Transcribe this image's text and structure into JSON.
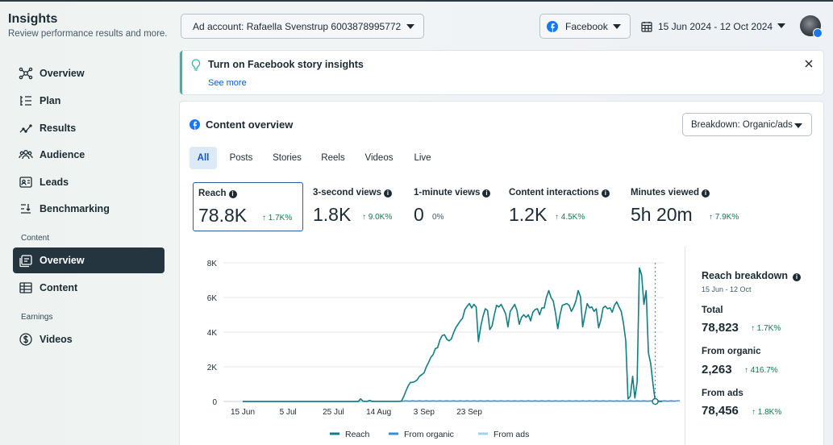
{
  "app": {
    "title": "Insights",
    "subtitle": "Review performance results and more."
  },
  "sidebar": {
    "items": [
      {
        "label": "Overview",
        "icon": "network-icon"
      },
      {
        "label": "Plan",
        "icon": "plan-list-icon"
      },
      {
        "label": "Results",
        "icon": "trend-icon"
      },
      {
        "label": "Audience",
        "icon": "people-icon"
      },
      {
        "label": "Leads",
        "icon": "id-card-icon"
      },
      {
        "label": "Benchmarking",
        "icon": "benchmark-icon"
      }
    ],
    "content_section": "Content",
    "content_items": [
      {
        "label": "Overview",
        "icon": "content-overview-icon",
        "active": true
      },
      {
        "label": "Content",
        "icon": "table-icon"
      }
    ],
    "earnings_section": "Earnings",
    "earnings_items": [
      {
        "label": "Videos",
        "icon": "dollar-icon"
      }
    ]
  },
  "topbar": {
    "ad_account": "Ad account: Rafaella Svenstrup 6003878995772",
    "platform": "Facebook",
    "date_range": "15 Jun 2024 - 12 Oct 2024"
  },
  "banner": {
    "title": "Turn on Facebook story insights",
    "link": "See more"
  },
  "content": {
    "title": "Content overview",
    "breakdown": "Breakdown: Organic/ads",
    "tabs": [
      "All",
      "Posts",
      "Stories",
      "Reels",
      "Videos",
      "Live"
    ],
    "active_tab": "All",
    "metrics": [
      {
        "label": "Reach",
        "value": "78.8K",
        "change": "↑ 1.7K%"
      },
      {
        "label": "3-second views",
        "value": "1.8K",
        "change": "↑ 9.0K%"
      },
      {
        "label": "1-minute views",
        "value": "0",
        "change": "0%"
      },
      {
        "label": "Content interactions",
        "value": "1.2K",
        "change": "↑ 4.5K%"
      },
      {
        "label": "Minutes viewed",
        "value": "5h 20m",
        "change": "↑ 7.9K%"
      }
    ]
  },
  "reach_breakdown": {
    "title": "Reach breakdown",
    "date": "15 Jun - 12 Oct",
    "rows": [
      {
        "label": "Total",
        "value": "78,823",
        "change": "↑ 1.7K%"
      },
      {
        "label": "From organic",
        "value": "2,263",
        "change": "↑ 416.7%"
      },
      {
        "label": "From ads",
        "value": "78,456",
        "change": "↑ 1.8K%"
      }
    ]
  },
  "chart_data": {
    "type": "line",
    "x_ticks": [
      "15 Jun",
      "5 Jul",
      "25 Jul",
      "14 Aug",
      "3 Sep",
      "23 Sep"
    ],
    "y_ticks": [
      "0",
      "2K",
      "4K",
      "6K",
      "8K"
    ],
    "ylim": [
      0,
      8000
    ],
    "colors": {
      "reach": "#137d84",
      "organic": "#3b8fd1",
      "ads": "#9fd2ee"
    },
    "series": [
      {
        "name": "Reach",
        "values": [
          0,
          0,
          0,
          0,
          0,
          0,
          0,
          0,
          0,
          0,
          0,
          0,
          0,
          0,
          0,
          0,
          0,
          0,
          0,
          0,
          0,
          0,
          0,
          0,
          0,
          0,
          0,
          0,
          0,
          0,
          0,
          0,
          0,
          0,
          0,
          0,
          0,
          0,
          0,
          0,
          0,
          0,
          0,
          0,
          0,
          0,
          0,
          0,
          0,
          0,
          0,
          0,
          150,
          20,
          10,
          10,
          60,
          10,
          10,
          10,
          10,
          10,
          10,
          10,
          10,
          10,
          10,
          10,
          10,
          10,
          20,
          280,
          600,
          900,
          1100,
          1100,
          1150,
          1250,
          1450,
          1550,
          1650,
          2000,
          2250,
          2550,
          2700,
          3050,
          3100,
          3550,
          3800,
          3850,
          3600,
          3500,
          3600,
          3950,
          4250,
          4450,
          4650,
          4800,
          5300,
          5500,
          5650,
          5400,
          5600,
          5450,
          3450,
          4300,
          4900,
          5350,
          5250,
          4150,
          4350,
          5000,
          5550,
          5450,
          5600,
          5350,
          5050,
          4300,
          5200,
          5400,
          5600,
          5250,
          4450,
          4850,
          5000,
          4850,
          5000,
          4650,
          5150,
          5300,
          5350,
          5000,
          5400,
          5400,
          6000,
          6400,
          6000,
          5800,
          5100,
          4200,
          5000,
          5550,
          5600,
          5650,
          5550,
          5200,
          5450,
          5800,
          6400,
          6050,
          4300,
          5000,
          5650,
          5400,
          5450,
          5200,
          5350,
          4250,
          4700,
          5400,
          5500,
          5350,
          5400,
          5150,
          5550,
          5750,
          5450,
          5200,
          4500,
          3500,
          150,
          300,
          1450,
          200,
          1100,
          7700,
          7300,
          5600,
          6400,
          2800,
          2200,
          1000,
          0,
          0,
          0,
          0
        ]
      },
      {
        "name": "From organic",
        "values": [
          0,
          0,
          0,
          0,
          0,
          0,
          0,
          0,
          0,
          0,
          0,
          0,
          0,
          0,
          0,
          0,
          0,
          0,
          0,
          0,
          0,
          0,
          0,
          0,
          0,
          0,
          0,
          0,
          0,
          0,
          0,
          0,
          0,
          0,
          0,
          0,
          0,
          0,
          0,
          0,
          0,
          0,
          0,
          0,
          0,
          0,
          0,
          0,
          0,
          0,
          0,
          0,
          150,
          20,
          10,
          10,
          60,
          10,
          10,
          10,
          10,
          10,
          10,
          10,
          10,
          10,
          10,
          10,
          10,
          10,
          20,
          30,
          40,
          30,
          30,
          40,
          30,
          30,
          40,
          30,
          30,
          40,
          30,
          30,
          40,
          30,
          30,
          40,
          30,
          30,
          40,
          30,
          30,
          40,
          30,
          30,
          40,
          30,
          30,
          40,
          30,
          30,
          40,
          30,
          30,
          40,
          30,
          30,
          40,
          30,
          30,
          40,
          30,
          30,
          40,
          30,
          30,
          40,
          30,
          30,
          40,
          30,
          30,
          40,
          30,
          30,
          40,
          30,
          30,
          40,
          30,
          30,
          40,
          30,
          30,
          40,
          30,
          30,
          40,
          30,
          30,
          40,
          30,
          30,
          40,
          30,
          30,
          40,
          30,
          30,
          40,
          30,
          30,
          40,
          30,
          30,
          40,
          30,
          30,
          40,
          30,
          30,
          40,
          30,
          30,
          40,
          30,
          30,
          40,
          30,
          30,
          40,
          30,
          30,
          40,
          30,
          30,
          40,
          30,
          30,
          40,
          30,
          30,
          40,
          30,
          30,
          40,
          30,
          30,
          40,
          30,
          30,
          40,
          30,
          30,
          0,
          0,
          0,
          0
        ]
      },
      {
        "name": "From ads",
        "values": [
          0,
          0,
          0,
          0,
          0,
          0,
          0,
          0,
          0,
          0,
          0,
          0,
          0,
          0,
          0,
          0,
          0,
          0,
          0,
          0,
          0,
          0,
          0,
          0,
          0,
          0,
          0,
          0,
          0,
          0,
          0,
          0,
          0,
          0,
          0,
          0,
          0,
          0,
          0,
          0,
          0,
          0,
          0,
          0,
          0,
          0,
          0,
          0,
          0,
          0,
          0,
          0,
          0,
          0,
          0,
          0,
          0,
          0,
          0,
          0,
          0,
          0,
          0,
          0,
          0,
          0,
          0,
          0,
          0,
          0,
          0,
          0,
          0,
          0,
          0,
          0,
          0,
          0,
          0,
          0,
          0,
          0,
          0,
          0,
          0,
          0,
          0,
          0,
          0,
          0,
          0,
          0,
          0,
          0,
          0,
          0,
          0,
          0,
          0,
          0,
          0,
          0,
          0,
          0,
          0,
          0,
          0,
          0,
          0,
          0,
          0,
          0,
          0,
          0,
          0,
          0,
          0,
          0,
          0,
          0,
          0,
          0,
          0,
          0,
          0,
          0,
          0,
          0,
          0,
          0,
          0,
          0,
          0,
          0,
          0,
          0,
          0,
          0,
          0,
          0,
          0,
          0,
          0,
          0,
          0,
          0,
          0,
          0,
          0,
          0,
          0,
          0,
          0,
          0,
          0,
          0,
          0,
          0,
          0,
          0,
          0,
          0,
          0,
          0,
          0,
          0,
          0,
          0,
          0,
          0,
          0,
          0,
          0,
          0,
          0,
          0,
          0,
          0,
          0,
          0,
          0,
          0,
          0,
          0,
          0,
          0,
          0,
          0,
          0,
          0,
          0,
          0
        ]
      }
    ],
    "legend": [
      "Reach",
      "From organic",
      "From ads"
    ],
    "legend_position": "bottom"
  }
}
